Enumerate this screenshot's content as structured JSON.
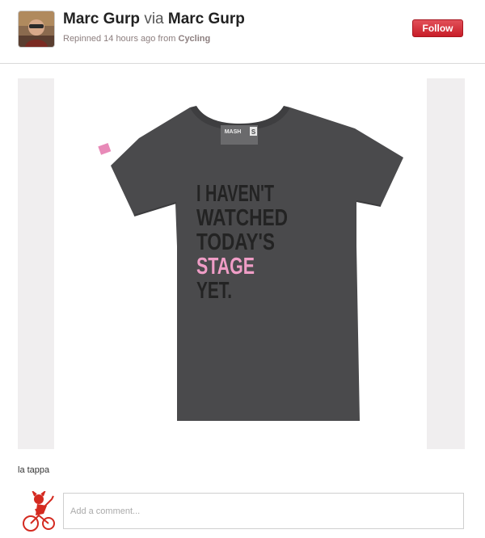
{
  "header": {
    "user_name": "Marc Gurp",
    "via_text": "via",
    "via_user_name": "Marc Gurp",
    "repinned_text": "Repinned 14 hours ago from",
    "board_name": "Cycling",
    "follow_label": "Follow"
  },
  "pin": {
    "shirt_lines": [
      "I HAVEN'T",
      "WATCHED",
      "TODAY'S",
      "STAGE",
      "YET."
    ],
    "tag_brand": "MASH",
    "tag_size": "S",
    "description": "la tappa"
  },
  "comment": {
    "placeholder": "Add a comment..."
  },
  "colors": {
    "follow_button": "#cb2027",
    "shirt": "#4a4a4c",
    "highlight_text": "#ef9dc6",
    "image_padding": "#f0eeef"
  },
  "icons": [
    "avatar-photo",
    "devil-cyclist-avatar"
  ]
}
